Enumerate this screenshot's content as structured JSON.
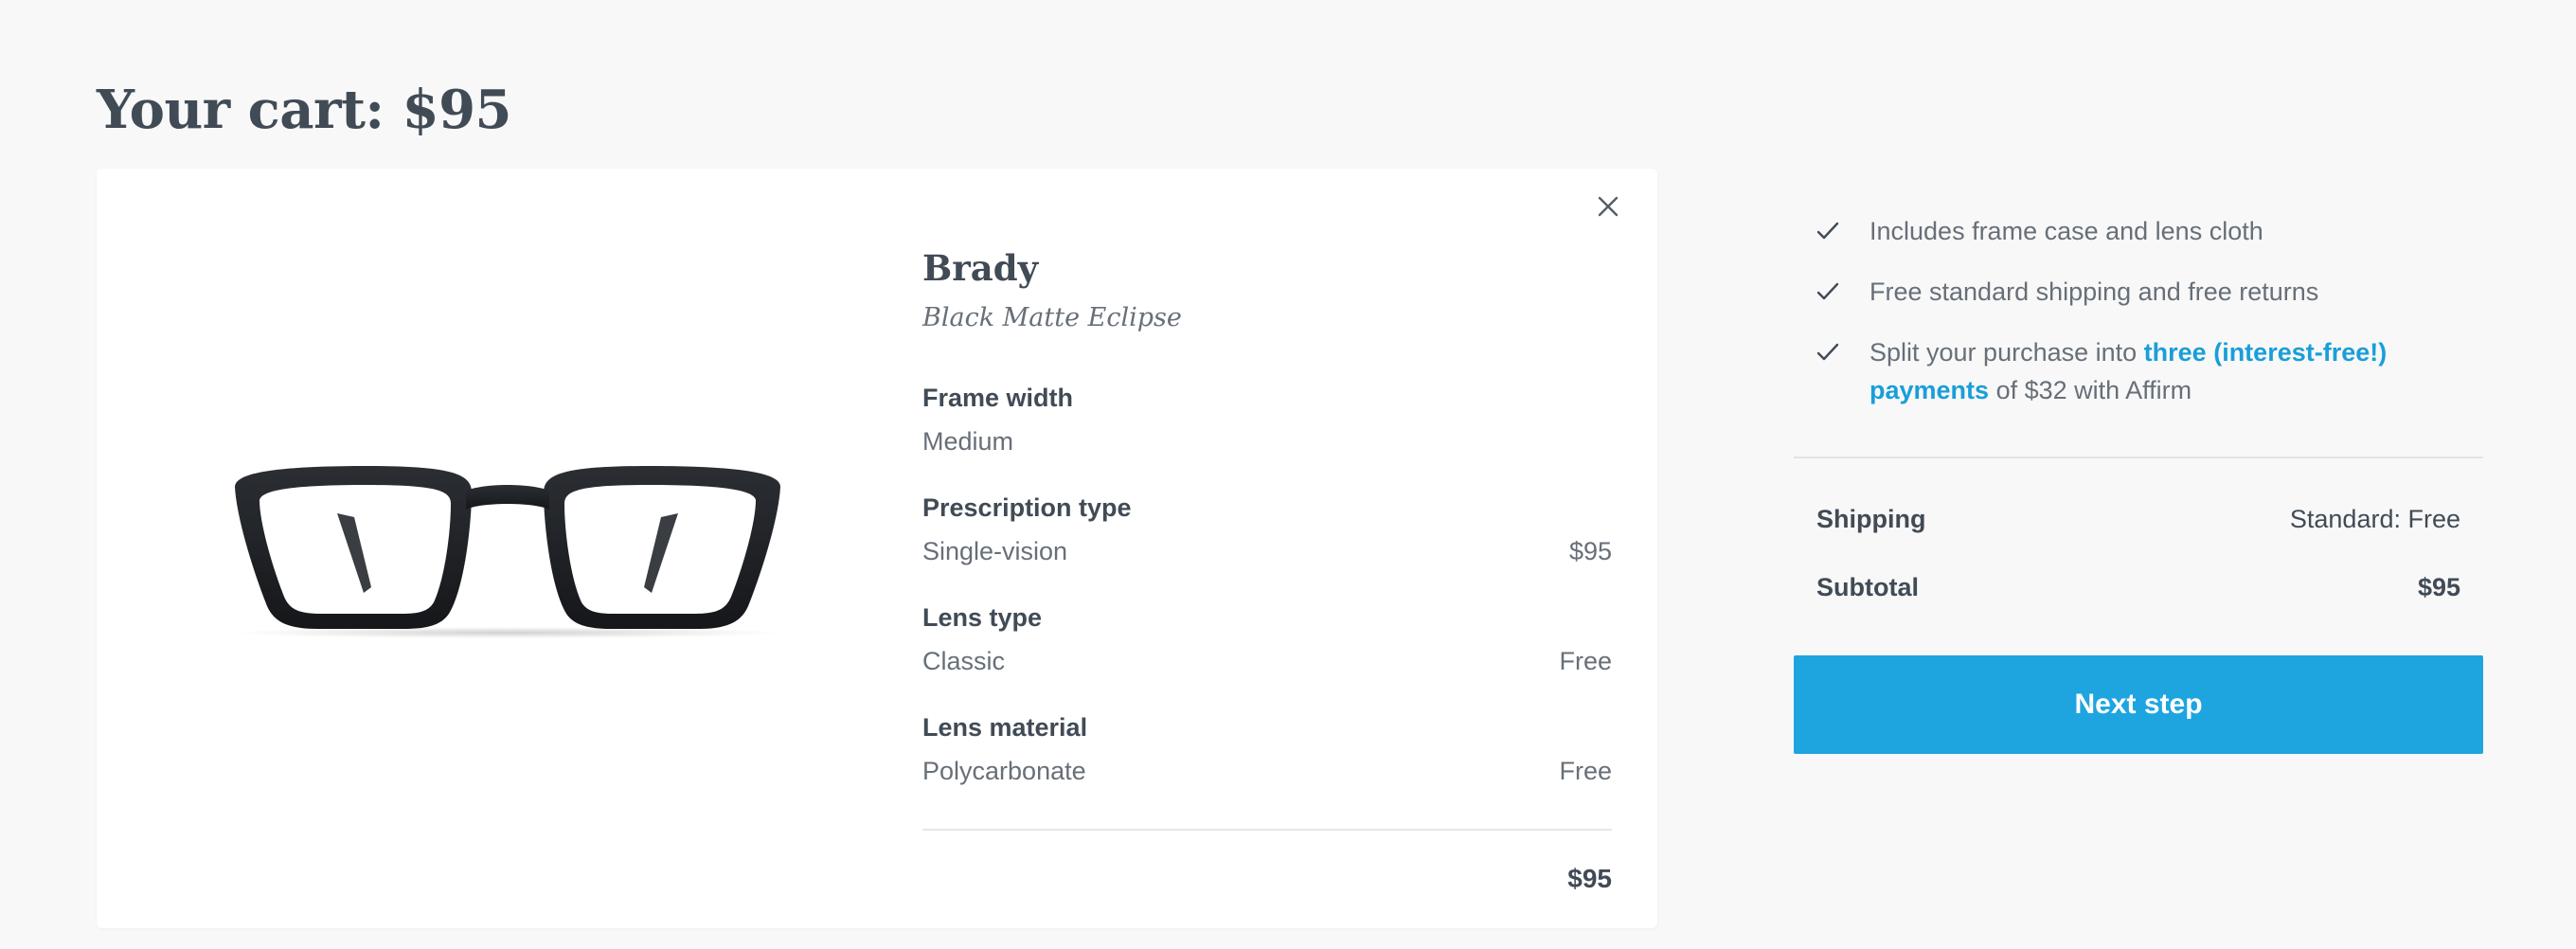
{
  "header": {
    "title": "Your cart: $95"
  },
  "product": {
    "name": "Brady",
    "color": "Black Matte Eclipse",
    "options": [
      {
        "label": "Frame width",
        "value": "Medium",
        "price": ""
      },
      {
        "label": "Prescription type",
        "value": "Single-vision",
        "price": "$95"
      },
      {
        "label": "Lens type",
        "value": "Classic",
        "price": "Free"
      },
      {
        "label": "Lens material",
        "value": "Polycarbonate",
        "price": "Free"
      }
    ],
    "total": "$95",
    "image_icon": "eyeglasses-image",
    "remove_icon": "close-icon"
  },
  "benefits": {
    "items": [
      {
        "text": "Includes frame case and lens cloth"
      },
      {
        "text": "Free standard shipping and free returns"
      }
    ],
    "affirm": {
      "prefix": "Split your purchase into ",
      "link_text": "three (interest-free!) payments",
      "suffix": " of $32 with Affirm"
    },
    "check_icon": "check-icon"
  },
  "summary": {
    "shipping_label": "Shipping",
    "shipping_value": "Standard: Free",
    "subtotal_label": "Subtotal",
    "subtotal_value": "$95"
  },
  "actions": {
    "next_label": "Next step"
  },
  "colors": {
    "accent": "#1ea5e0",
    "link": "#1a9ed9",
    "text_dark": "#414b56",
    "text_muted": "#676f78",
    "background": "#f8f8f8"
  }
}
